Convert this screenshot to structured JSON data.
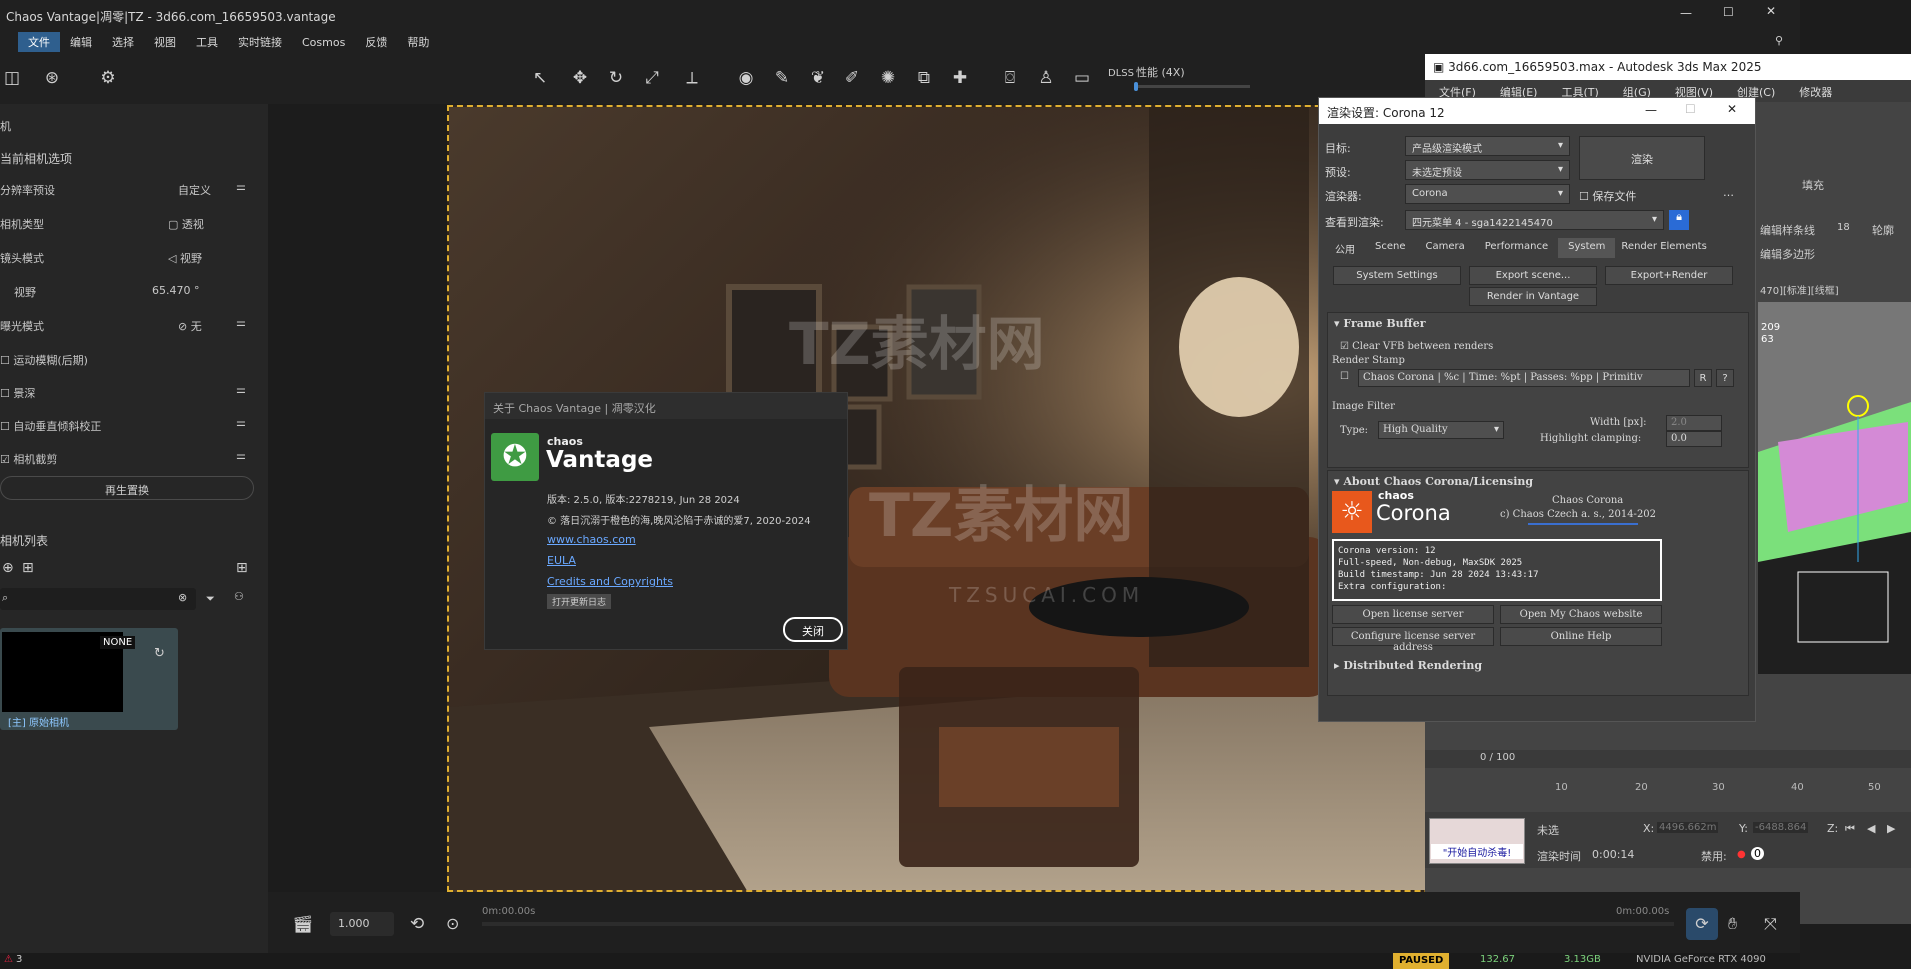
{
  "vantage": {
    "title": "Chaos Vantage|凋零|TZ - 3d66.com_16659503.vantage",
    "menu": [
      "文件",
      "编辑",
      "选择",
      "视图",
      "工具",
      "实时链接",
      "Cosmos",
      "反馈",
      "帮助"
    ],
    "perf_label": "性能 (4X)",
    "dlss": "DLSS"
  },
  "left": {
    "cam_options": "当前相机选项",
    "rows": [
      {
        "label": "分辨率预设",
        "value": "自定义"
      },
      {
        "label": "相机类型",
        "value": "透视"
      },
      {
        "label": "镜头模式",
        "value": "视野"
      },
      {
        "label": "视野",
        "value": "65.470 °"
      },
      {
        "label": "曝光模式",
        "value": "无"
      }
    ],
    "checks": [
      "运动模糊(后期)",
      "景深",
      "自动垂直倾斜校正",
      "相机截剪"
    ],
    "regen": "再生置换",
    "cam_list": "相机列表",
    "thumb_badge": "NONE",
    "thumb_caption": "[主] 原始相机"
  },
  "about": {
    "title": "关于 Chaos Vantage | 凋零汉化",
    "brand_small": "chaos",
    "brand_big": "Vantage",
    "version": "版本: 2.5.0, 版本:2278219, Jun 28 2024",
    "copyright": "© 落日沉溺于橙色的海,晚风沦陷于赤诚的爱7, 2020-2024",
    "link": "www.chaos.com",
    "eula": "EULA",
    "credits": "Credits and Copyrights",
    "changelog": "打开更新日志",
    "close": "关闭"
  },
  "watermark": {
    "text": "TZ素材网",
    "sub": "TZSUCAI.COM"
  },
  "render": {
    "title": "渲染设置: Corona 12",
    "target_label": "目标:",
    "target_val": "产品级渲染模式",
    "preset_label": "预设:",
    "preset_val": "未选定预设",
    "renderer_label": "渲染器:",
    "renderer_val": "Corona",
    "save_file": "保存文件",
    "view_label": "查看到渲染:",
    "view_val": "四元菜单 4 - sga1422145470",
    "render_btn": "渲染",
    "tabs": [
      "公用",
      "Scene",
      "Camera",
      "Performance",
      "System",
      "Render Elements"
    ],
    "sys_btns": [
      "System Settings",
      "Export scene...",
      "Export+Render",
      "Render in Vantage"
    ],
    "fb_title": "Frame Buffer",
    "clear_vfb": "Clear VFB between renders",
    "stamp_label": "Render Stamp",
    "stamp_val": "Chaos Corona | %c | Time: %pt | Passes: %pp | Primitiv",
    "stamp_r": "R",
    "stamp_q": "?",
    "img_filter": "Image Filter",
    "type_label": "Type:",
    "type_val": "High Quality",
    "width_label": "Width [px]:",
    "width_val": "2.0",
    "hl_label": "Highlight clamping:",
    "hl_val": "0.0",
    "about_title": "About Chaos Corona/Licensing",
    "corona_small": "chaos",
    "corona_big": "Corona",
    "corona_name": "Chaos Corona",
    "corona_copy": "c) Chaos Czech a. s., 2014-202",
    "info": [
      "Corona version: 12",
      "Full-speed, Non-debug, MaxSDK 2025",
      "Build timestamp: Jun 28 2024 13:43:17",
      "Extra configuration:"
    ],
    "lic_btns": [
      "Open license server",
      "Open My Chaos website",
      "Configure license server address",
      "Online Help"
    ],
    "dist": "Distributed Rendering"
  },
  "max": {
    "title": "3d66.com_16659503.max - Autodesk 3ds Max 2025",
    "menu": [
      "文件(F)",
      "编辑(E)",
      "工具(T)",
      "组(G)",
      "视图(V)",
      "创建(C)",
      "修改器"
    ],
    "fill": "填充",
    "spline": "编辑样条线",
    "poly": "编辑多边形",
    "outline": "轮廓",
    "num18": "18",
    "vp_label": "470][标准][线框]",
    "n209": "209",
    "n63": "63",
    "frames": "0 / 100",
    "ticks": [
      "10",
      "20",
      "30",
      "40",
      "50"
    ],
    "notsel": "未选",
    "x_label": "X:",
    "x_val": "4496.662m",
    "y_label": "Y:",
    "y_val": "-6488.864",
    "z_label": "Z:",
    "render_time_label": "渲染时间",
    "render_time": "0:00:14",
    "disable": "禁用:",
    "autokill": "\"开始自动杀毒!",
    "zero": "0"
  },
  "bottom": {
    "speed": "1.000",
    "t0": "0m:00.00s",
    "t1": "0m:00.00s"
  },
  "status": {
    "num": "3",
    "paused": "PAUSED",
    "fps": "132.67",
    "mem": "3.13GB",
    "gpu": "NVIDIA GeForce RTX 4090"
  }
}
